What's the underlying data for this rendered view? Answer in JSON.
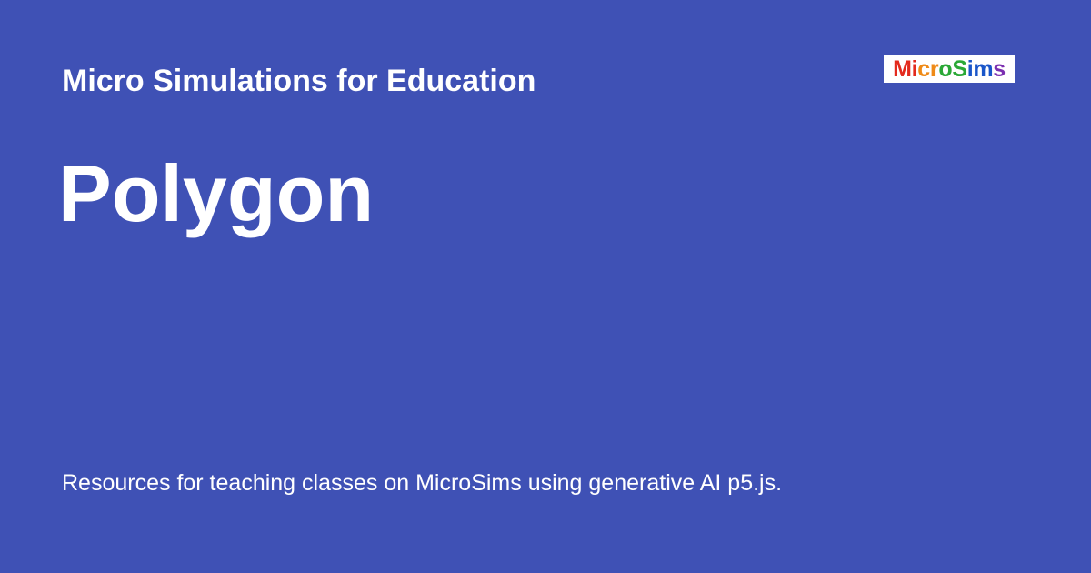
{
  "header": {
    "site_name": "Micro Simulations for Education"
  },
  "page": {
    "title": "Polygon",
    "description": "Resources for teaching classes on MicroSims using generative AI p5.js."
  },
  "logo": {
    "text": "MicroSims",
    "letter_colors": [
      "#e32a1d",
      "#e32a1d",
      "#ef8a17",
      "#ef8a17",
      "#2aa836",
      "#2aa836",
      "#1a56c9",
      "#1a56c9",
      "#7b2fb0"
    ]
  },
  "colors": {
    "background": "#3f51b5",
    "text": "#ffffff",
    "logo_background": "#ffffff"
  }
}
